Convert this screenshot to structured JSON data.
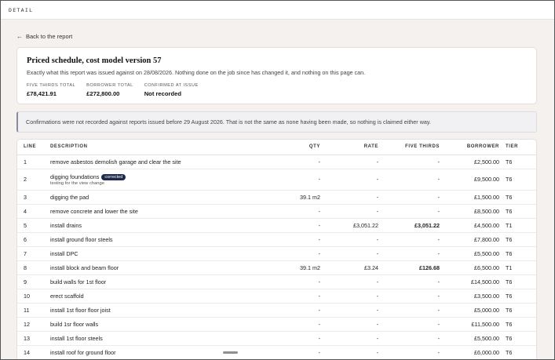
{
  "topbar": {
    "label": "DETAIL"
  },
  "back": {
    "label": "Back to the report"
  },
  "card": {
    "title": "Priced schedule, cost model version 57",
    "subtitle": "Exactly what this report was issued against on 28/08/2026. Nothing done on the job since has changed it, and nothing on this page can.",
    "stats": [
      {
        "label": "FIVE THIRDS TOTAL",
        "value": "£78,421.91"
      },
      {
        "label": "BORROWER TOTAL",
        "value": "£272,800.00"
      },
      {
        "label": "CONFIRMED AT ISSUE",
        "value": "Not recorded"
      }
    ]
  },
  "notice": "Confirmations were not recorded against reports issued before 29 August 2026. That is not the same as none having been made, so nothing is claimed either way.",
  "table": {
    "headers": {
      "line": "LINE",
      "description": "DESCRIPTION",
      "qty": "QTY",
      "rate": "RATE",
      "five_thirds": "FIVE THIRDS",
      "borrower": "BORROWER",
      "tier": "TIER"
    },
    "rows": [
      {
        "line": "1",
        "description": "remove asbestos demolish garage and clear the site",
        "qty": "-",
        "rate": "-",
        "five_thirds": "-",
        "borrower": "£2,500.00",
        "tier": "T6"
      },
      {
        "line": "2",
        "description": "digging foundations",
        "badge": "corrected",
        "note": "testing for the view change",
        "qty": "-",
        "rate": "-",
        "five_thirds": "-",
        "borrower": "£9,500.00",
        "tier": "T6"
      },
      {
        "line": "3",
        "description": "digging the pad",
        "qty": "39.1 m2",
        "rate": "-",
        "five_thirds": "-",
        "borrower": "£1,500.00",
        "tier": "T6"
      },
      {
        "line": "4",
        "description": "remove concrete and lower the site",
        "qty": "-",
        "rate": "-",
        "five_thirds": "-",
        "borrower": "£8,500.00",
        "tier": "T6"
      },
      {
        "line": "5",
        "description": "install drains",
        "qty": "-",
        "rate": "£3,051.22",
        "five_thirds": "£3,051.22",
        "borrower": "£4,500.00",
        "tier": "T1"
      },
      {
        "line": "6",
        "description": "install ground floor steels",
        "qty": "-",
        "rate": "-",
        "five_thirds": "-",
        "borrower": "£7,800.00",
        "tier": "T6"
      },
      {
        "line": "7",
        "description": "install DPC",
        "qty": "-",
        "rate": "-",
        "five_thirds": "-",
        "borrower": "£5,500.00",
        "tier": "T6"
      },
      {
        "line": "8",
        "description": "install block and beam floor",
        "qty": "39.1 m2",
        "rate": "£3.24",
        "five_thirds": "£126.68",
        "borrower": "£6,500.00",
        "tier": "T1"
      },
      {
        "line": "9",
        "description": "build walls for 1st floor",
        "qty": "-",
        "rate": "-",
        "five_thirds": "-",
        "borrower": "£14,500.00",
        "tier": "T6"
      },
      {
        "line": "10",
        "description": "erect scaffold",
        "qty": "-",
        "rate": "-",
        "five_thirds": "-",
        "borrower": "£3,500.00",
        "tier": "T6"
      },
      {
        "line": "11",
        "description": "install 1st floor floor joist",
        "qty": "-",
        "rate": "-",
        "five_thirds": "-",
        "borrower": "£5,000.00",
        "tier": "T6"
      },
      {
        "line": "12",
        "description": "build 1sr floor walls",
        "qty": "-",
        "rate": "-",
        "five_thirds": "-",
        "borrower": "£11,500.00",
        "tier": "T6"
      },
      {
        "line": "13",
        "description": "install 1st floor steels",
        "qty": "-",
        "rate": "-",
        "five_thirds": "-",
        "borrower": "£5,500.00",
        "tier": "T6"
      },
      {
        "line": "14",
        "description": "install roof for ground floor",
        "qty": "-",
        "rate": "-",
        "five_thirds": "-",
        "borrower": "£6,000.00",
        "tier": "T6"
      }
    ]
  },
  "icons": {
    "back": "arrow-left-icon"
  },
  "colors": {
    "badge": "#1f2a4a",
    "background": "#f5f1ee"
  }
}
